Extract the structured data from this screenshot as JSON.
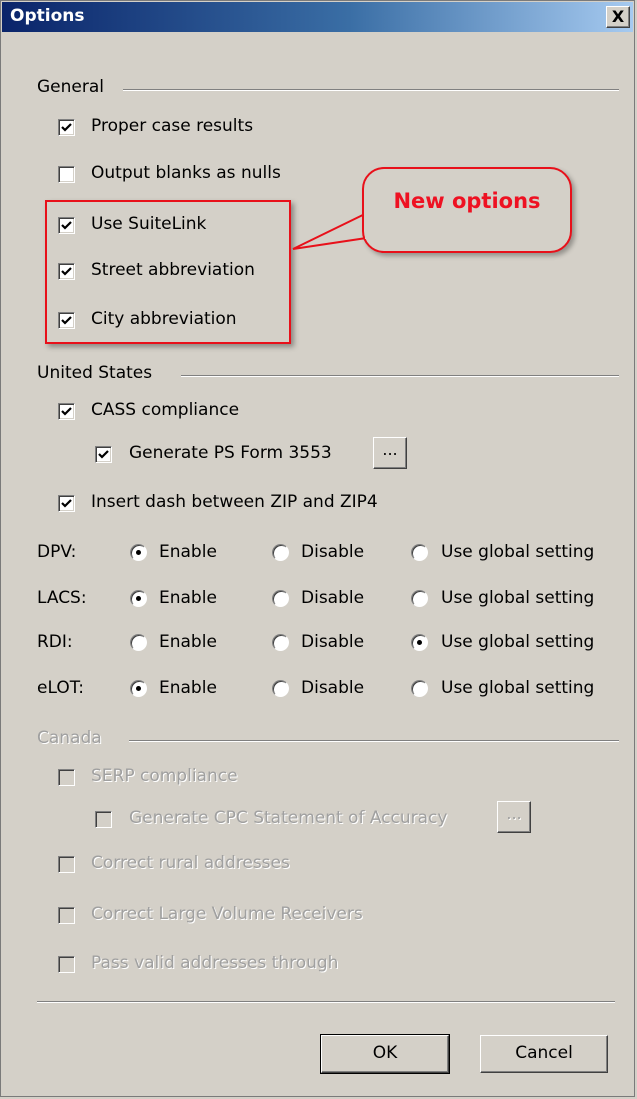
{
  "window": {
    "title": "Options",
    "close_label": "X"
  },
  "general": {
    "label": "General",
    "options": [
      {
        "label": "Proper case results",
        "checked": true
      },
      {
        "label": "Output blanks as nulls",
        "checked": false
      },
      {
        "label": "Use SuiteLink",
        "checked": true
      },
      {
        "label": "Street abbreviation",
        "checked": true
      },
      {
        "label": "City abbreviation",
        "checked": true
      }
    ]
  },
  "callout": {
    "text": "New options",
    "color": "#ee1122"
  },
  "united_states": {
    "label": "United States",
    "cass_compliance": {
      "label": "CASS compliance",
      "checked": true
    },
    "generate_ps_form": {
      "label": "Generate PS Form 3553",
      "checked": true,
      "button_label": "..."
    },
    "insert_dash": {
      "label": "Insert dash between ZIP and ZIP4",
      "checked": true
    },
    "radio_options": [
      "Enable",
      "Disable",
      "Use global setting"
    ],
    "radio_rows": [
      {
        "label": "DPV:",
        "selected": "Enable"
      },
      {
        "label": "LACS:",
        "selected": "Enable"
      },
      {
        "label": "RDI:",
        "selected": "Use global setting"
      },
      {
        "label": "eLOT:",
        "selected": "Enable"
      }
    ]
  },
  "canada": {
    "label": "Canada",
    "enabled": false,
    "serp_compliance": {
      "label": "SERP compliance",
      "checked": false
    },
    "generate_cpc": {
      "label": "Generate CPC Statement of Accuracy",
      "checked": false,
      "button_label": "..."
    },
    "correct_rural": {
      "label": "Correct rural addresses",
      "checked": false
    },
    "correct_lvr": {
      "label": "Correct Large Volume Receivers",
      "checked": false
    },
    "pass_valid": {
      "label": "Pass valid addresses through",
      "checked": false
    }
  },
  "buttons": {
    "ok_label": "OK",
    "cancel_label": "Cancel"
  }
}
